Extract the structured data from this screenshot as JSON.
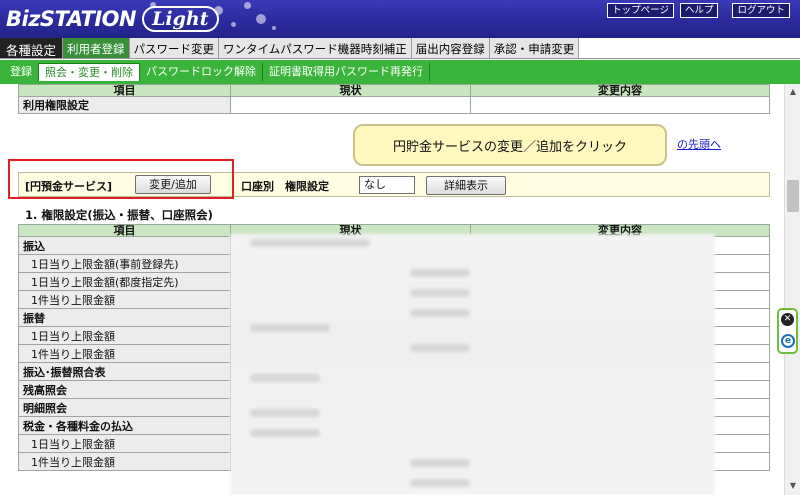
{
  "header": {
    "logo_main": "BizSTATION",
    "logo_sub": "Light",
    "links": [
      "トップページ",
      "ヘルプ",
      "ログアウト"
    ]
  },
  "main_tabs": [
    "各種設定",
    "利用者登録",
    "パスワード変更",
    "ワンタイムパスワード機器時刻補正",
    "届出内容登録",
    "承認・申請変更"
  ],
  "sub_tabs": [
    "登録",
    "照会・変更・削除",
    "パスワードロック解除",
    "証明書取得用パスワード再発行"
  ],
  "perm_table": {
    "headers": [
      "項目",
      "現状",
      "変更内容"
    ],
    "row_label": "利用権限設定"
  },
  "top_link": "の先頭へ",
  "callout": "円貯金サービスの変更／追加をクリック",
  "service": {
    "title": "[円預金サービス]",
    "change_button": "変更/追加",
    "account_label": "口座別　権限設定",
    "account_value": "なし",
    "detail_button": "詳細表示"
  },
  "limits": {
    "section_title": "1. 権限設定(振込・振替、口座照会)",
    "headers": [
      "項目",
      "現状",
      "変更内容"
    ],
    "rows": [
      {
        "label": "振込",
        "type": "group"
      },
      {
        "label": "1日当り上限金額(事前登録先)",
        "type": "item"
      },
      {
        "label": "1日当り上限金額(都度指定先)",
        "type": "item"
      },
      {
        "label": "1件当り上限金額",
        "type": "item"
      },
      {
        "label": "振替",
        "type": "group"
      },
      {
        "label": "1日当り上限金額",
        "type": "item"
      },
      {
        "label": "1件当り上限金額",
        "type": "item"
      },
      {
        "label": "振込･振替照合表",
        "type": "group"
      },
      {
        "label": "残高照会",
        "type": "group"
      },
      {
        "label": "明細照会",
        "type": "group"
      },
      {
        "label": "税金・各種料金の払込",
        "type": "group"
      },
      {
        "label": "1日当り上限金額",
        "type": "item"
      },
      {
        "label": "1件当り上限金額",
        "type": "item"
      }
    ]
  },
  "colors": {
    "header_blue": "#2b2b9e",
    "sub_tab_green": "#3bb43b",
    "table_header_green": "#c8e6c0",
    "highlight_red": "#e02020",
    "callout_yellow": "#fff9c0"
  }
}
